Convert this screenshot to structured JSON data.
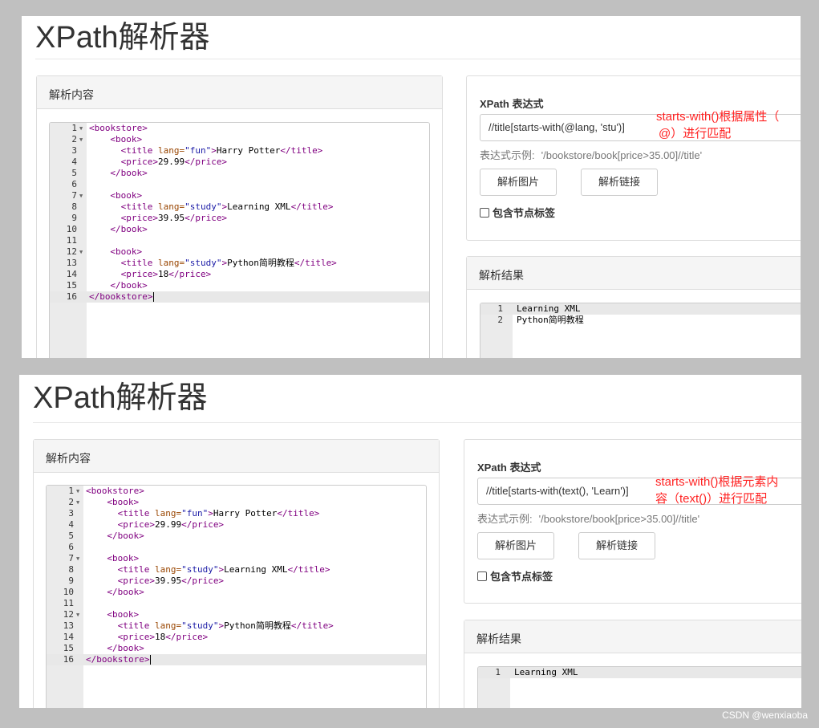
{
  "shots": [
    {
      "page_title": "XPath解析器",
      "content_panel": {
        "heading": "解析内容"
      },
      "code_lines": [
        {
          "n": "1",
          "fold": true
        },
        {
          "n": "2",
          "fold": true
        },
        {
          "n": "3",
          "fold": false
        },
        {
          "n": "4",
          "fold": false
        },
        {
          "n": "5",
          "fold": false
        },
        {
          "n": "6",
          "fold": false
        },
        {
          "n": "7",
          "fold": true
        },
        {
          "n": "8",
          "fold": false
        },
        {
          "n": "9",
          "fold": false
        },
        {
          "n": "10",
          "fold": false
        },
        {
          "n": "11",
          "fold": false
        },
        {
          "n": "12",
          "fold": true
        },
        {
          "n": "13",
          "fold": false
        },
        {
          "n": "14",
          "fold": false
        },
        {
          "n": "15",
          "fold": false
        },
        {
          "n": "16",
          "fold": false
        }
      ],
      "xpath_label": "XPath 表达式",
      "xpath_value": "//title[starts-with(@lang, 'stu')]",
      "annotation": [
        "starts-with()根据属性（",
        "@）进行匹配"
      ],
      "example_label": "表达式示例:",
      "example_value": "'/bookstore/book[price>35.00]//title'",
      "btn_image": "解析图片",
      "btn_link": "解析链接",
      "include_tags_label": "包含节点标签",
      "result_panel": {
        "heading": "解析结果"
      },
      "results": [
        {
          "n": "1",
          "text": "Learning XML"
        },
        {
          "n": "2",
          "text": "Python简明教程"
        }
      ]
    },
    {
      "page_title": "XPath解析器",
      "content_panel": {
        "heading": "解析内容"
      },
      "code_lines": [
        {
          "n": "1",
          "fold": true
        },
        {
          "n": "2",
          "fold": true
        },
        {
          "n": "3",
          "fold": false
        },
        {
          "n": "4",
          "fold": false
        },
        {
          "n": "5",
          "fold": false
        },
        {
          "n": "6",
          "fold": false
        },
        {
          "n": "7",
          "fold": true
        },
        {
          "n": "8",
          "fold": false
        },
        {
          "n": "9",
          "fold": false
        },
        {
          "n": "10",
          "fold": false
        },
        {
          "n": "11",
          "fold": false
        },
        {
          "n": "12",
          "fold": true
        },
        {
          "n": "13",
          "fold": false
        },
        {
          "n": "14",
          "fold": false
        },
        {
          "n": "15",
          "fold": false
        },
        {
          "n": "16",
          "fold": false
        }
      ],
      "xpath_label": "XPath 表达式",
      "xpath_value": "//title[starts-with(text(), 'Learn')]",
      "annotation": [
        "starts-with()根据元素内",
        "容（text()）进行匹配"
      ],
      "example_label": "表达式示例:",
      "example_value": "'/bookstore/book[price>35.00]//title'",
      "btn_image": "解析图片",
      "btn_link": "解析链接",
      "include_tags_label": "包含节点标签",
      "result_panel": {
        "heading": "解析结果"
      },
      "results": [
        {
          "n": "1",
          "text": "Learning XML"
        }
      ]
    }
  ],
  "code_tokens": {
    "bookstore_open": "<bookstore>",
    "bookstore_close": "</bookstore>",
    "book_open": "<book>",
    "book_close": "</book>",
    "title_open": "<title",
    "title_close": "</title>",
    "gt": ">",
    "price_open": "<price>",
    "price_close": "</price>",
    "lang_attr": "lang=",
    "fun": "\"fun\"",
    "study": "\"study\"",
    "harry": "Harry Potter",
    "learning": "Learning XML",
    "python": "Python简明教程",
    "p1": "29.99",
    "p2": "39.95",
    "p3": "18"
  },
  "watermark": "CSDN @wenxiaoba",
  "colors": {
    "annotation": "#ff2222",
    "tag": "#800080",
    "attr": "#994500",
    "value": "#1a1aa6",
    "backdrop": "#c0c0c0"
  },
  "icons": {
    "fold": "fold-triangle-icon"
  }
}
